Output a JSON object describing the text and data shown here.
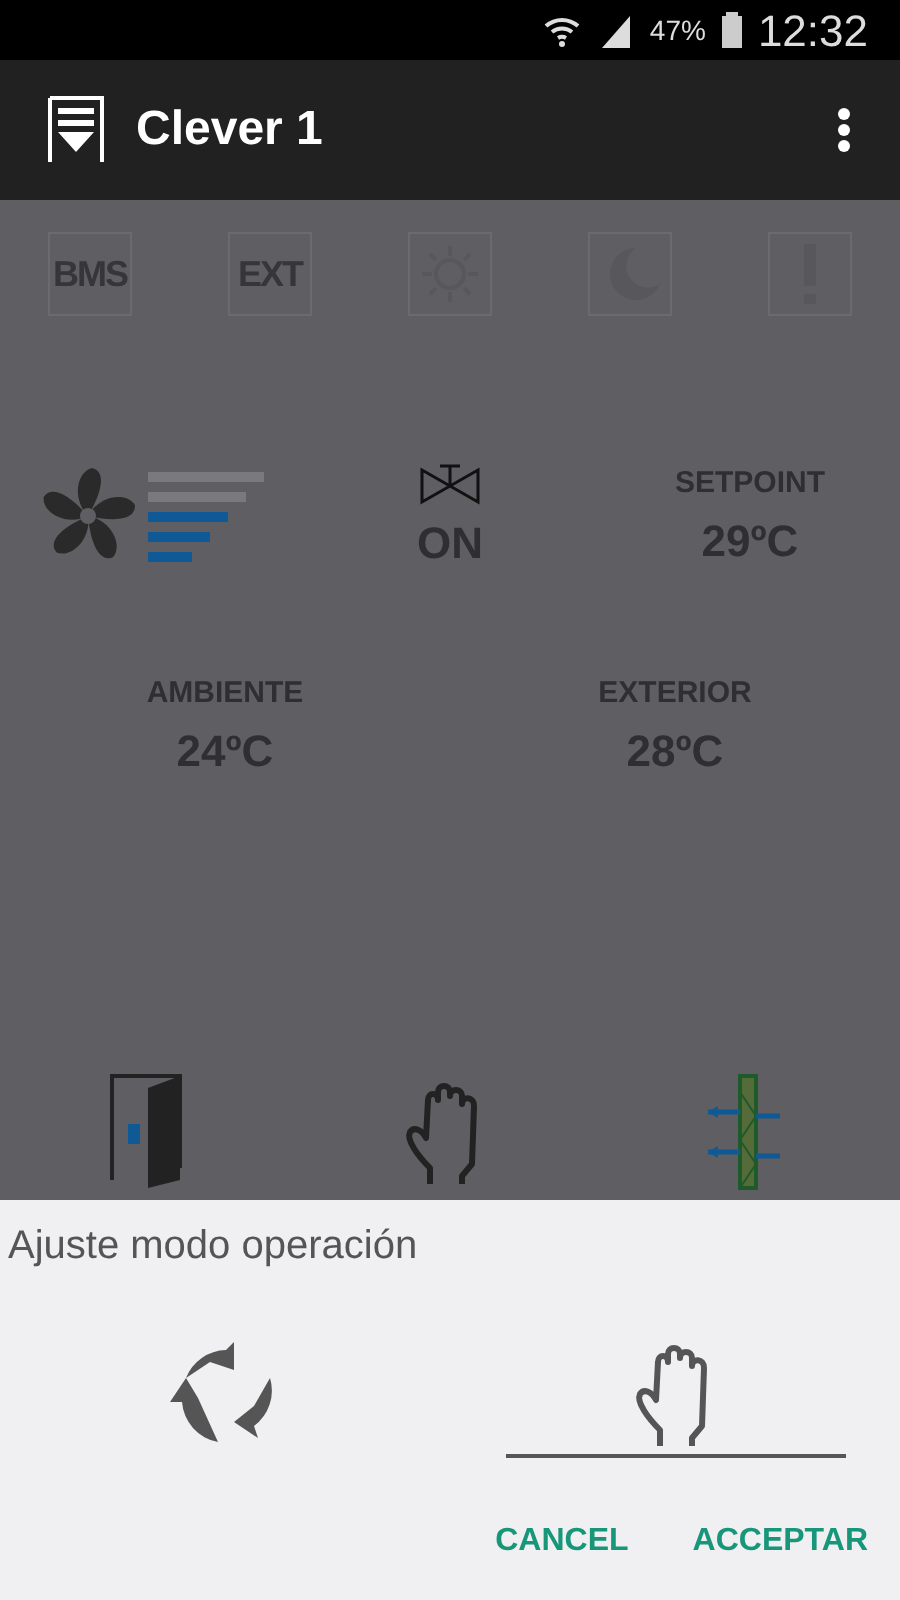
{
  "status_bar": {
    "battery": "47%",
    "time": "12:32"
  },
  "app_bar": {
    "title": "Clever 1"
  },
  "mode_badges": [
    {
      "kind": "text",
      "label": "BMS"
    },
    {
      "kind": "text",
      "label": "EXT"
    },
    {
      "kind": "sun"
    },
    {
      "kind": "moon"
    },
    {
      "kind": "alert"
    }
  ],
  "fan": {
    "level": 0.6
  },
  "valve": {
    "state": "ON"
  },
  "setpoint": {
    "label": "SETPOINT",
    "value": "29ºC"
  },
  "temperatures": [
    {
      "label": "AMBIENTE",
      "value": "24ºC"
    },
    {
      "label": "EXTERIOR",
      "value": "28ºC"
    }
  ],
  "dialog": {
    "title": "Ajuste modo operación",
    "options": [
      {
        "kind": "auto",
        "selected": false
      },
      {
        "kind": "manual",
        "selected": true
      }
    ],
    "buttons": [
      "CANCEL",
      "ACCEPTAR"
    ]
  }
}
